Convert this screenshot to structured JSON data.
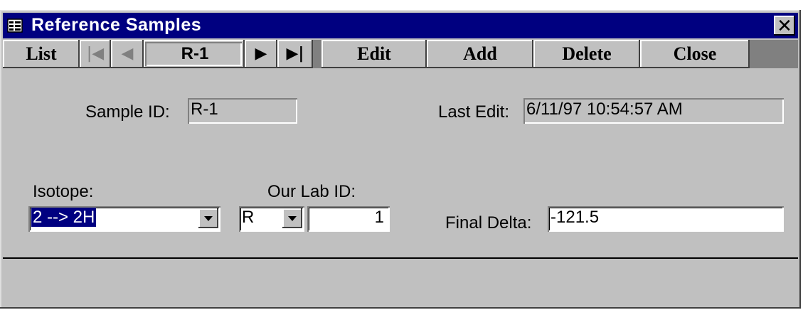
{
  "window": {
    "title": "Reference Samples",
    "close_glyph": "✕"
  },
  "toolbar": {
    "list_label": "List",
    "first_glyph": "⏮",
    "prev_glyph": "◀",
    "record_value": "R-1",
    "next_glyph": "▶",
    "last_glyph": "▶|",
    "edit_label": "Edit",
    "add_label": "Add",
    "delete_label": "Delete",
    "close_label": "Close"
  },
  "form": {
    "sample_id_label": "Sample ID:",
    "sample_id_value": "R-1",
    "last_edit_label": "Last Edit:",
    "last_edit_value": "6/11/97 10:54:57 AM",
    "isotope_label": "Isotope:",
    "isotope_value": "2 --> 2H",
    "our_lab_id_label": "Our Lab ID:",
    "lab_prefix_value": "R",
    "lab_number_value": "1",
    "final_delta_label": "Final Delta:",
    "final_delta_value": "-121.5"
  }
}
